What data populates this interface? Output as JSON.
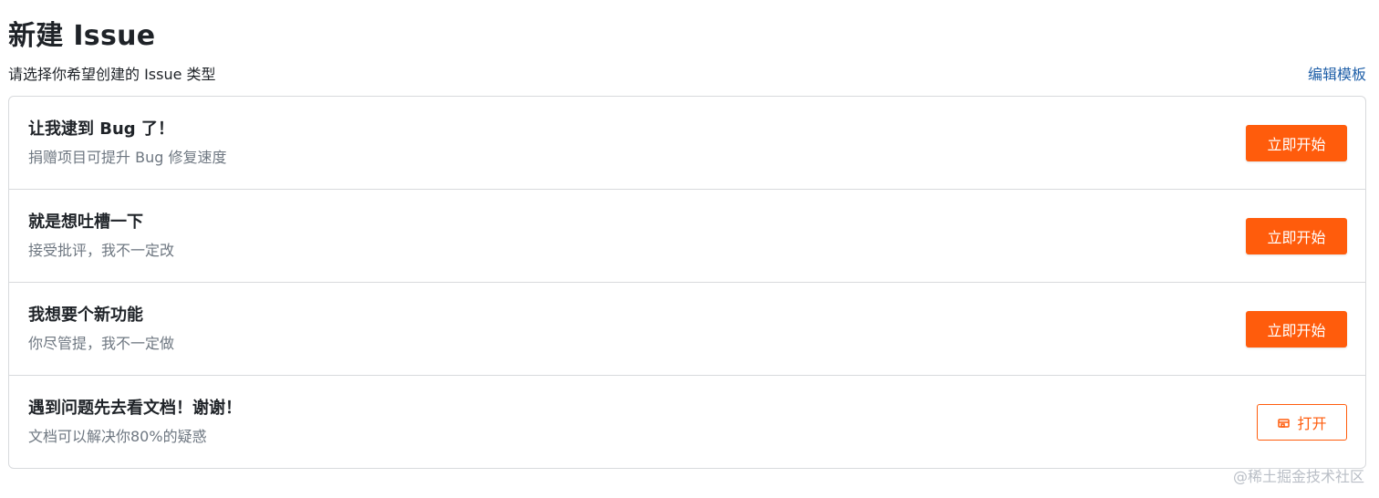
{
  "page": {
    "title": "新建 Issue",
    "subtitle": "请选择你希望创建的 Issue 类型",
    "edit_template_label": "编辑模板"
  },
  "items": [
    {
      "title": "让我逮到 Bug 了！",
      "description": "捐赠项目可提升 Bug 修复速度",
      "button_label": "立即开始"
    },
    {
      "title": "就是想吐槽一下",
      "description": "接受批评，我不一定改",
      "button_label": "立即开始"
    },
    {
      "title": "我想要个新功能",
      "description": "你尽管提，我不一定做",
      "button_label": "立即开始"
    },
    {
      "title": "遇到问题先去看文档！谢谢！",
      "description": "文档可以解决你80%的疑惑",
      "button_label": "打开",
      "button_icon": "external-link-icon"
    }
  ],
  "watermark": "@稀土掘金技术社区",
  "colors": {
    "accent": "#ff5c0c",
    "link": "#1f5fa8",
    "border": "#d8dadd",
    "muted_text": "#6e7781"
  }
}
